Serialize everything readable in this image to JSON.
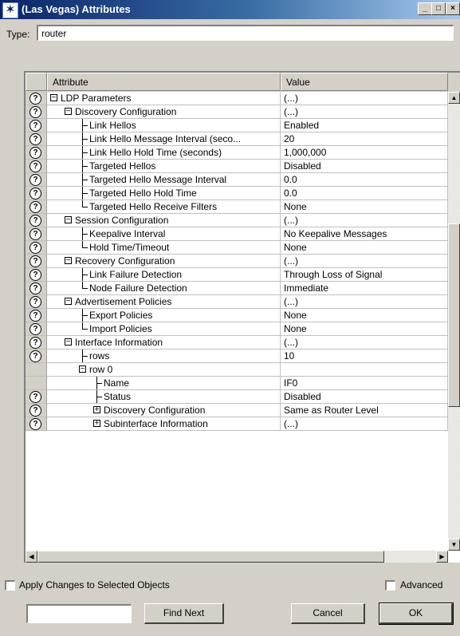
{
  "window": {
    "title": "(Las Vegas) Attributes",
    "controls": {
      "minimize": "_",
      "maximize": "□",
      "close": "×"
    }
  },
  "type": {
    "label": "Type:",
    "value": "router"
  },
  "table": {
    "columns": {
      "attribute": "Attribute",
      "value": "Value"
    },
    "rows": [
      {
        "help": true,
        "depth": 0,
        "expander": "minus",
        "attr": "LDP Parameters",
        "value": "(...)"
      },
      {
        "help": true,
        "depth": 1,
        "expander": "minus",
        "attr": "Discovery Configuration",
        "value": "(...)"
      },
      {
        "help": true,
        "depth": 2,
        "branch": "tee",
        "attr": "Link Hellos",
        "value": "Enabled"
      },
      {
        "help": true,
        "depth": 2,
        "branch": "tee",
        "attr": "Link Hello Message Interval (seco...",
        "value": "20"
      },
      {
        "help": true,
        "depth": 2,
        "branch": "tee",
        "attr": "Link Hello Hold Time (seconds)",
        "value": "1,000,000"
      },
      {
        "help": true,
        "depth": 2,
        "branch": "tee",
        "attr": "Targeted Hellos",
        "value": "Disabled"
      },
      {
        "help": true,
        "depth": 2,
        "branch": "tee",
        "attr": "Targeted Hello Message Interval",
        "value": "0.0"
      },
      {
        "help": true,
        "depth": 2,
        "branch": "tee",
        "attr": "Targeted Hello Hold Time",
        "value": "0.0"
      },
      {
        "help": true,
        "depth": 2,
        "branch": "ell",
        "attr": "Targeted Hello Receive Filters",
        "value": "None"
      },
      {
        "help": true,
        "depth": 1,
        "expander": "minus",
        "attr": "Session Configuration",
        "value": "(...)"
      },
      {
        "help": true,
        "depth": 2,
        "branch": "tee",
        "attr": "Keepalive Interval",
        "value": "No Keepalive Messages"
      },
      {
        "help": true,
        "depth": 2,
        "branch": "ell",
        "attr": "Hold Time/Timeout",
        "value": "None"
      },
      {
        "help": true,
        "depth": 1,
        "expander": "minus",
        "attr": "Recovery Configuration",
        "value": "(...)"
      },
      {
        "help": true,
        "depth": 2,
        "branch": "tee",
        "attr": "Link Failure Detection",
        "value": "Through Loss of Signal"
      },
      {
        "help": true,
        "depth": 2,
        "branch": "ell",
        "attr": "Node Failure Detection",
        "value": "Immediate"
      },
      {
        "help": true,
        "depth": 1,
        "expander": "minus",
        "attr": "Advertisement Policies",
        "value": "(...)"
      },
      {
        "help": true,
        "depth": 2,
        "branch": "tee",
        "attr": "Export Policies",
        "value": "None"
      },
      {
        "help": true,
        "depth": 2,
        "branch": "ell",
        "attr": "Import Policies",
        "value": "None"
      },
      {
        "help": true,
        "depth": 1,
        "expander": "minus",
        "attr": "Interface Information",
        "value": "(...)"
      },
      {
        "help": true,
        "depth": 2,
        "branch": "tee",
        "attr": "rows",
        "value": "10"
      },
      {
        "help": false,
        "depth": 2,
        "expander": "minus",
        "attr": "row 0",
        "value": ""
      },
      {
        "help": false,
        "depth": 3,
        "branch": "tee",
        "attr": "Name",
        "value": "IF0"
      },
      {
        "help": true,
        "depth": 3,
        "branch": "tee",
        "attr": "Status",
        "value": "Disabled"
      },
      {
        "help": true,
        "depth": 3,
        "expander": "plus",
        "attr": "Discovery Configuration",
        "value": "Same as Router Level"
      },
      {
        "help": true,
        "depth": 3,
        "expander": "plus",
        "attr": "Subinterface Information",
        "value": "(...)"
      }
    ]
  },
  "icons": {
    "help": "?",
    "minus": "−",
    "plus": "+",
    "up": "▲",
    "down": "▼",
    "left": "◀",
    "right": "▶",
    "app": "✶"
  },
  "footer": {
    "apply_label": "Apply Changes to Selected Objects",
    "apply_checked": false,
    "advanced_label": "Advanced",
    "advanced_checked": false,
    "find_value": "",
    "find_next": "Find Next",
    "cancel": "Cancel",
    "ok": "OK"
  }
}
